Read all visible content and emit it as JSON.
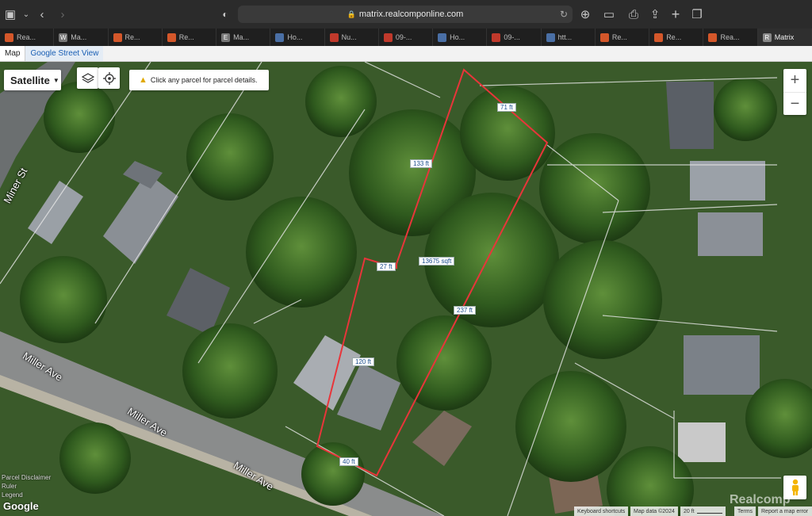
{
  "browser": {
    "url": "matrix.realcomponline.com"
  },
  "tabs": [
    {
      "label": "Rea...",
      "icon": "realcomp-icon",
      "color": "#d4572a"
    },
    {
      "label": "Ma...",
      "icon": "W",
      "color": "#777777"
    },
    {
      "label": "Re...",
      "icon": "realcomp-icon",
      "color": "#d4572a"
    },
    {
      "label": "Re...",
      "icon": "realcomp-icon",
      "color": "#d4572a"
    },
    {
      "label": "Ma...",
      "icon": "E",
      "color": "#777777"
    },
    {
      "label": "Ho...",
      "icon": "doc-icon",
      "color": "#4a6fa5"
    },
    {
      "label": "Nu...",
      "icon": "flag-icon",
      "color": "#c0392b"
    },
    {
      "label": "09-...",
      "icon": "flag-icon",
      "color": "#c0392b"
    },
    {
      "label": "Ho...",
      "icon": "doc-icon",
      "color": "#4a6fa5"
    },
    {
      "label": "09-...",
      "icon": "flag-icon",
      "color": "#c0392b"
    },
    {
      "label": "htt...",
      "icon": "doc-icon",
      "color": "#4a6fa5"
    },
    {
      "label": "Re...",
      "icon": "realcomp-icon",
      "color": "#d4572a"
    },
    {
      "label": "Re...",
      "icon": "realcomp-icon",
      "color": "#d4572a"
    },
    {
      "label": "Rea...",
      "icon": "realcomp-icon",
      "color": "#d4572a"
    },
    {
      "label": "Matrix",
      "icon": "R",
      "color": "#888888",
      "active": true
    }
  ],
  "map_tabs": {
    "map": "Map",
    "street_view": "Google Street View"
  },
  "map_controls": {
    "map_type": "Satellite",
    "notice": "Click any parcel for parcel details.",
    "zoom_in": "+",
    "zoom_out": "−"
  },
  "parcel": {
    "dimensions": {
      "top": "71 ft",
      "left_upper": "133 ft",
      "notch": "27 ft",
      "area": "13675 sqft",
      "right": "237 ft",
      "left_lower": "120 ft",
      "bottom": "40 ft"
    },
    "outline_color": "#e8353a"
  },
  "streets": {
    "miner": "Miner St",
    "miller_1": "Miller Ave",
    "miller_2": "Miller Ave",
    "miller_3": "Miller Ave"
  },
  "overlays": {
    "disclaimer": "Parcel Disclaimer",
    "ruler": "Ruler",
    "legend": "Legend"
  },
  "footer": {
    "google": "Google",
    "shortcuts": "Keyboard shortcuts",
    "map_data": "Map data ©2024",
    "scale": "20 ft",
    "terms": "Terms",
    "report": "Report a map error"
  },
  "watermark": "Realcomp"
}
